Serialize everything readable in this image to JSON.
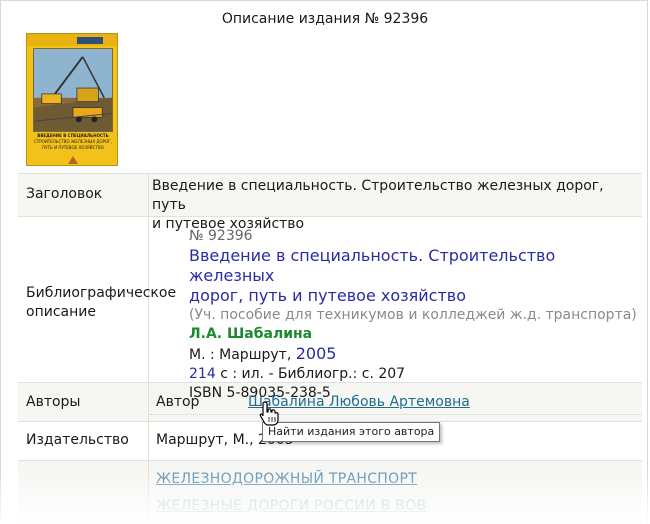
{
  "page": {
    "title": "Описание издания № 92396"
  },
  "fields": {
    "title_label": "Заголовок",
    "title_value_line1": "Введение в специальность. Строительство железных дорог, путь",
    "title_value_line2": "и путевое хозяйство",
    "biblio_label_line1": "Библиографическое",
    "biblio_label_line2": "описание",
    "authors_label": "Авторы",
    "author_role": "Автор",
    "author_name": "Шабалина Любовь Артемовна",
    "publisher_label": "Издательство",
    "publisher_value": "Маршрут, М., 2005"
  },
  "biblio": {
    "number": "№ 92396",
    "title_line1": "Введение в специальность. Строительство железных",
    "title_line2": "дорог, путь и путевое хозяйство",
    "note": "(Уч. пособие для техникумов и колледжей ж.д. транспорта)",
    "author": "Л.А. Шабалина",
    "place_publisher": "М. : Маршрут,",
    "year": "2005",
    "pages": "214",
    "pages_rest": "с : ил. - Библиогр.: с. 207",
    "isbn": "ISBN 5-89035-238-5"
  },
  "topics": [
    "ЖЕЛЕЗНОДОРОЖНЫЙ ТРАНСПОРТ",
    "ЖЕЛЕЗНЫЕ ДОРОГИ РОССИИ В ВОВ"
  ],
  "tooltip": {
    "text": "Найти издания этого автора"
  },
  "cover": {
    "title_line1": "ВВЕДЕНИЕ В СПЕЦИАЛЬНОСТЬ",
    "title_line2": "СТРОИТЕЛЬСТВО ЖЕЛЕЗНЫХ ДОРОГ,",
    "title_line3": "ПУТЬ И ПУТЕВОЕ ХОЗЯЙСТВО"
  },
  "colors": {
    "link_blue": "#2a2ba3",
    "author_green": "#1b8a2e",
    "row_shade": "#f6f6f3",
    "cover_yellow": "#f3c21a"
  }
}
